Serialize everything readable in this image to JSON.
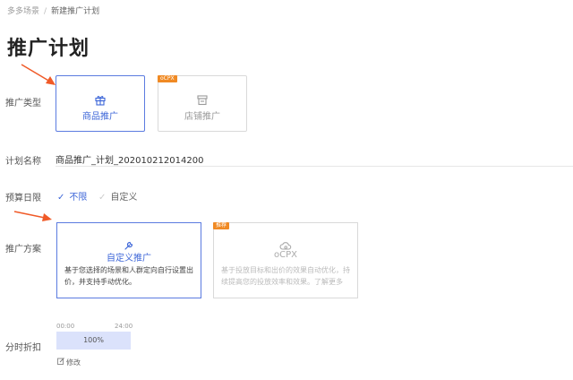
{
  "breadcrumb": {
    "parent": "多多场景",
    "separator": "/",
    "current": "新建推广计划"
  },
  "page_title": "推广计划",
  "labels": {
    "promo_type": "推广类型",
    "plan_name": "计划名称",
    "budget": "预算日限",
    "promo_plan": "推广方案",
    "time_discount": "分时折扣"
  },
  "promo_types": [
    {
      "label": "商品推广",
      "icon": "gift-icon",
      "selected": true
    },
    {
      "label": "店铺推广",
      "icon": "store-icon",
      "selected": false,
      "tag": "oCPX"
    }
  ],
  "plan_name_value": "商品推广_计划_202010212014200",
  "budget_options": [
    {
      "label": "不限",
      "selected": true
    },
    {
      "label": "自定义",
      "selected": false
    }
  ],
  "promo_plans": [
    {
      "title": "自定义推广",
      "icon": "wrench-icon",
      "desc": "基于您选择的场景和人群定向自行设置出价，并支持手动优化。",
      "selected": true
    },
    {
      "title": "oCPX",
      "icon": "cloud-gear-icon",
      "desc": "基于投放目标和出价的效果自动优化，持续提高您的投放效率和效果。了解更多",
      "selected": false,
      "tag": "推荐"
    }
  ],
  "time_discount": {
    "start": "00:00",
    "end": "24:00",
    "percent_label": "100%",
    "percent": 100,
    "edit_label": "修改"
  },
  "colors": {
    "accent": "#3d66d8",
    "tag": "#f08a24",
    "arrow": "#f05a28",
    "bar": "#dbe2fb"
  }
}
